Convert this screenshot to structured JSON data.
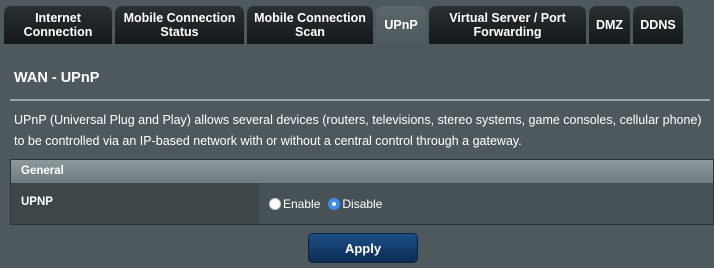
{
  "tabs": [
    {
      "label": "Internet\nConnection",
      "active": false
    },
    {
      "label": "Mobile Connection\nStatus",
      "active": false
    },
    {
      "label": "Mobile Connection\nScan",
      "active": false
    },
    {
      "label": "UPnP",
      "active": true
    },
    {
      "label": "Virtual Server / Port\nForwarding",
      "active": false
    },
    {
      "label": "DMZ",
      "active": false
    },
    {
      "label": "DDNS",
      "active": false
    }
  ],
  "page": {
    "title": "WAN - UPnP",
    "description": "UPnP (Universal Plug and Play) allows several devices (routers, televisions, stereo systems, game consoles, cellular phone) to be controlled via an IP-based network with or without a central control through a gateway."
  },
  "section": {
    "header": "General",
    "upnp_label": "UPNP",
    "options": [
      {
        "label": "Enable",
        "checked": false
      },
      {
        "label": "Disable",
        "checked": true
      }
    ]
  },
  "apply_label": "Apply",
  "colors": {
    "panel_bg": "#4d595d",
    "selected_radio": "#3d8ef0",
    "apply_button": "#1d4f88"
  }
}
